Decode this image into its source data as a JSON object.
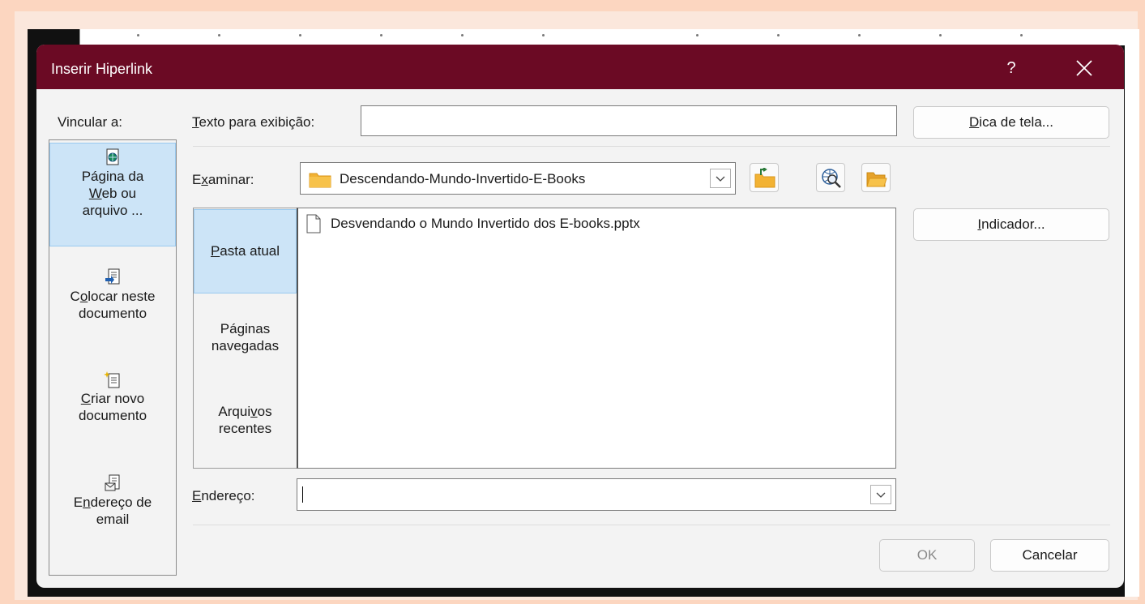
{
  "dialog": {
    "title": "Inserir Hiperlink",
    "help_label": "?"
  },
  "link_to": {
    "label": "Vincular a:",
    "items": [
      {
        "line1": "Página da",
        "line2_u": "W",
        "line2_rest": "eb ou",
        "line3": "arquivo ..."
      },
      {
        "line1_pre": "C",
        "line1_u": "o",
        "line1_rest": "locar neste",
        "line2": "documento"
      },
      {
        "line1_u": "C",
        "line1_rest": "riar novo",
        "line2": "documento"
      },
      {
        "line1_pre": "E",
        "line1_u": "n",
        "line1_rest": "dereço de",
        "line2": "email"
      }
    ]
  },
  "display_text": {
    "label_u": "T",
    "label_rest": "exto para exibição:",
    "value": ""
  },
  "screentip_button": {
    "u": "D",
    "rest": "ica de tela..."
  },
  "look_in": {
    "label_pre": "E",
    "label_u": "x",
    "label_rest": "aminar:",
    "folder": "Descendando-Mundo-Invertido-E-Books"
  },
  "places": [
    {
      "line1_u": "P",
      "line1_rest": "asta atual"
    },
    {
      "line1_pre": "Pá",
      "line1_u": "g",
      "line1_rest": "inas",
      "line2": "navegadas"
    },
    {
      "line1_pre": "Arqui",
      "line1_u": "v",
      "line1_rest": "os",
      "line2": "recentes"
    }
  ],
  "files": [
    {
      "name": "Desvendando o Mundo Invertido dos E-books.pptx"
    }
  ],
  "bookmark_button": {
    "u": "I",
    "rest": "ndicador..."
  },
  "address": {
    "label_u": "E",
    "label_rest": "ndereço:",
    "value": ""
  },
  "footer": {
    "ok": "OK",
    "cancel": "Cancelar"
  },
  "colors": {
    "titlebar": "#6b0a24",
    "selected": "#cce4f7",
    "page_border": "#fcd6c0"
  }
}
